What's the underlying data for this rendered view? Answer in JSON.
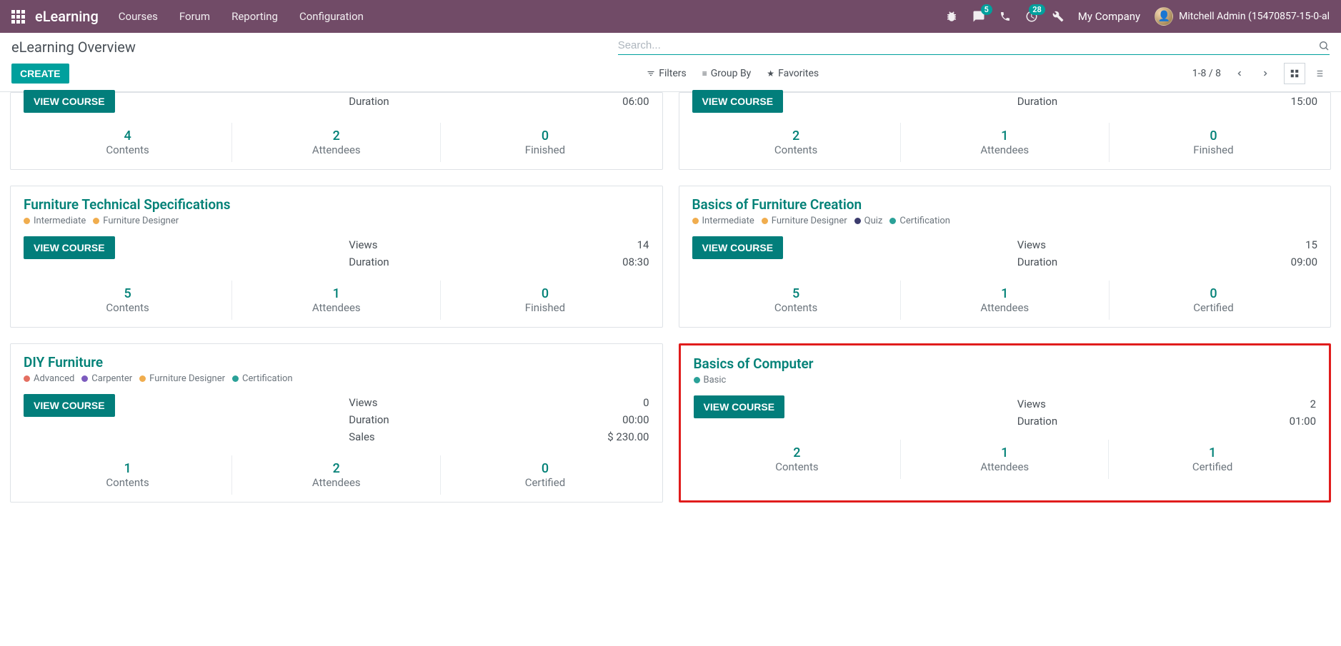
{
  "navbar": {
    "brand": "eLearning",
    "items": [
      "Courses",
      "Forum",
      "Reporting",
      "Configuration"
    ],
    "chat_badge": "5",
    "activity_badge": "28",
    "company": "My Company",
    "user": "Mitchell Admin (15470857-15-0-al"
  },
  "breadcrumb": "eLearning Overview",
  "search_placeholder": "Search...",
  "buttons": {
    "create": "CREATE",
    "view_course": "VIEW COURSE"
  },
  "filters": {
    "filters": "Filters",
    "groupby": "Group By",
    "favorites": "Favorites"
  },
  "pager": "1-8 / 8",
  "labels": {
    "views": "Views",
    "duration": "Duration",
    "sales": "Sales",
    "contents": "Contents",
    "attendees": "Attendees",
    "finished": "Finished",
    "certified": "Certified"
  },
  "tag_colors": {
    "intermediate": "#f0ad4e",
    "furniture_designer": "#f0ad4e",
    "advanced": "#e46f61",
    "carpenter": "#7c5bbe",
    "certification": "#2aa198",
    "quiz": "#3b3b6d",
    "basic": "#2aa198"
  },
  "cards": [
    {
      "partial": true,
      "stats": {
        "duration": "06:00"
      },
      "bottom": [
        {
          "num": "4",
          "lab": "Contents"
        },
        {
          "num": "2",
          "lab": "Attendees"
        },
        {
          "num": "0",
          "lab": "Finished"
        }
      ]
    },
    {
      "partial": true,
      "stats": {
        "duration": "15:00"
      },
      "bottom": [
        {
          "num": "2",
          "lab": "Contents"
        },
        {
          "num": "1",
          "lab": "Attendees"
        },
        {
          "num": "0",
          "lab": "Finished"
        }
      ]
    },
    {
      "title": "Furniture Technical Specifications",
      "tags": [
        {
          "label": "Intermediate",
          "color": "#f0ad4e"
        },
        {
          "label": "Furniture Designer",
          "color": "#f0ad4e"
        }
      ],
      "stats": {
        "views": "14",
        "duration": "08:30"
      },
      "bottom": [
        {
          "num": "5",
          "lab": "Contents"
        },
        {
          "num": "1",
          "lab": "Attendees"
        },
        {
          "num": "0",
          "lab": "Finished"
        }
      ]
    },
    {
      "title": "Basics of Furniture Creation",
      "tags": [
        {
          "label": "Intermediate",
          "color": "#f0ad4e"
        },
        {
          "label": "Furniture Designer",
          "color": "#f0ad4e"
        },
        {
          "label": "Quiz",
          "color": "#3b3b6d"
        },
        {
          "label": "Certification",
          "color": "#2aa198"
        }
      ],
      "stats": {
        "views": "15",
        "duration": "09:00"
      },
      "bottom": [
        {
          "num": "5",
          "lab": "Contents"
        },
        {
          "num": "1",
          "lab": "Attendees"
        },
        {
          "num": "0",
          "lab": "Certified"
        }
      ]
    },
    {
      "title": "DIY Furniture",
      "tags": [
        {
          "label": "Advanced",
          "color": "#e46f61"
        },
        {
          "label": "Carpenter",
          "color": "#7c5bbe"
        },
        {
          "label": "Furniture Designer",
          "color": "#f0ad4e"
        },
        {
          "label": "Certification",
          "color": "#2aa198"
        }
      ],
      "stats": {
        "views": "0",
        "duration": "00:00",
        "sales": "$ 230.00"
      },
      "bottom": [
        {
          "num": "1",
          "lab": "Contents"
        },
        {
          "num": "2",
          "lab": "Attendees"
        },
        {
          "num": "0",
          "lab": "Certified"
        }
      ]
    },
    {
      "title": "Basics of Computer",
      "highlight": true,
      "tags": [
        {
          "label": "Basic",
          "color": "#2aa198"
        }
      ],
      "stats": {
        "views": "2",
        "duration": "01:00"
      },
      "bottom": [
        {
          "num": "2",
          "lab": "Contents"
        },
        {
          "num": "1",
          "lab": "Attendees"
        },
        {
          "num": "1",
          "lab": "Certified"
        }
      ]
    }
  ]
}
